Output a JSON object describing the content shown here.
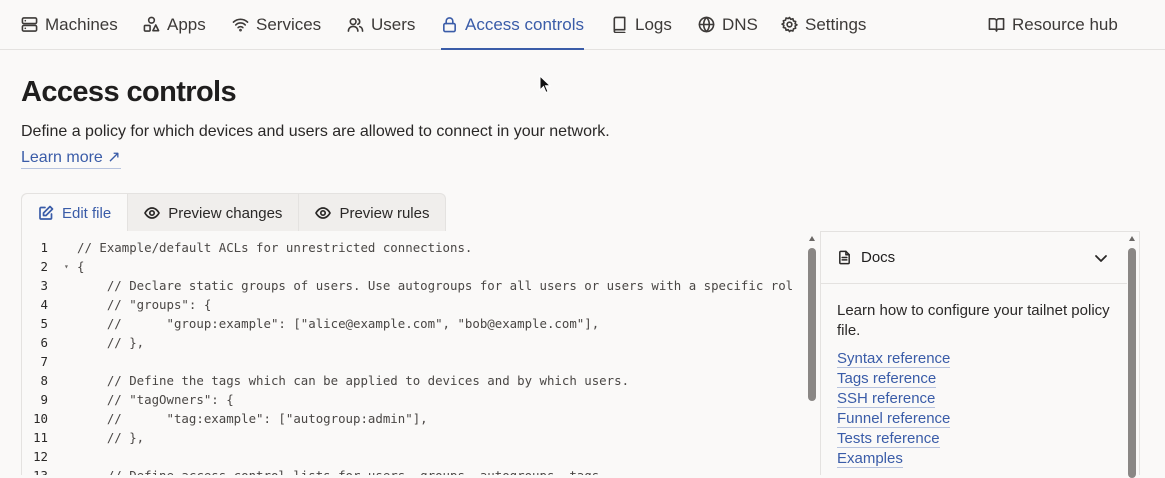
{
  "nav": {
    "items": [
      {
        "label": "Machines",
        "icon": "server-icon"
      },
      {
        "label": "Apps",
        "icon": "apps-icon"
      },
      {
        "label": "Services",
        "icon": "wifi-icon"
      },
      {
        "label": "Users",
        "icon": "users-icon"
      },
      {
        "label": "Access controls",
        "icon": "lock-icon",
        "active": true
      },
      {
        "label": "Logs",
        "icon": "book-icon"
      },
      {
        "label": "DNS",
        "icon": "globe-icon"
      },
      {
        "label": "Settings",
        "icon": "gear-icon"
      }
    ],
    "resource_hub": "Resource hub",
    "accent": "#3a5ca8"
  },
  "header": {
    "title": "Access controls",
    "description": "Define a policy for which devices and users are allowed to connect in your network.",
    "learn_more": "Learn more ↗"
  },
  "tabs": [
    {
      "label": "Edit file",
      "icon": "edit-icon",
      "active": true
    },
    {
      "label": "Preview changes",
      "icon": "eye-icon"
    },
    {
      "label": "Preview rules",
      "icon": "eye-icon"
    }
  ],
  "editor": {
    "lines": [
      {
        "n": "1",
        "fold": "",
        "text": "// Example/default ACLs for unrestricted connections."
      },
      {
        "n": "2",
        "fold": "▾",
        "text": "{"
      },
      {
        "n": "3",
        "fold": "",
        "text": "    // Declare static groups of users. Use autogroups for all users or users with a specific rol"
      },
      {
        "n": "4",
        "fold": "",
        "text": "    // \"groups\": {"
      },
      {
        "n": "5",
        "fold": "",
        "text": "    //      \"group:example\": [\"alice@example.com\", \"bob@example.com\"],"
      },
      {
        "n": "6",
        "fold": "",
        "text": "    // },"
      },
      {
        "n": "7",
        "fold": "",
        "text": ""
      },
      {
        "n": "8",
        "fold": "",
        "text": "    // Define the tags which can be applied to devices and by which users."
      },
      {
        "n": "9",
        "fold": "",
        "text": "    // \"tagOwners\": {"
      },
      {
        "n": "10",
        "fold": "",
        "text": "    //      \"tag:example\": [\"autogroup:admin\"],"
      },
      {
        "n": "11",
        "fold": "",
        "text": "    // },"
      },
      {
        "n": "12",
        "fold": "",
        "text": ""
      },
      {
        "n": "13",
        "fold": "",
        "text": "    // Define access control lists for users, groups, autogroups, tags,"
      }
    ]
  },
  "docs": {
    "title": "Docs",
    "body": "Learn how to configure your tailnet policy file.",
    "links": [
      "Syntax reference",
      "Tags reference",
      "SSH reference",
      "Funnel reference",
      "Tests reference",
      "Examples"
    ]
  }
}
